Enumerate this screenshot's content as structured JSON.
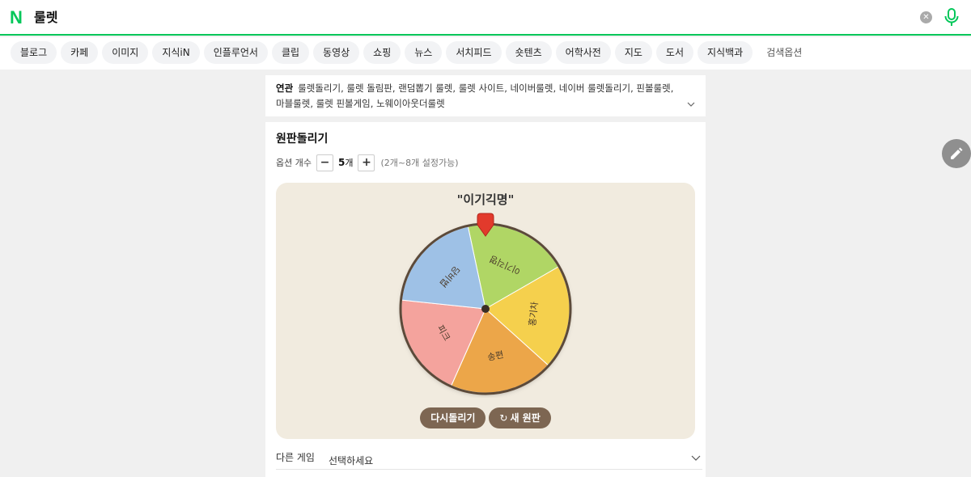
{
  "header": {
    "logo": "N",
    "query": "룰렛",
    "clear_icon": "close-circle-icon",
    "mic_icon": "microphone-icon"
  },
  "tabs": [
    "블로그",
    "카페",
    "이미지",
    "지식iN",
    "인플루언서",
    "클립",
    "동영상",
    "쇼핑",
    "뉴스",
    "서치피드",
    "숏텐츠",
    "어학사전",
    "지도",
    "도서",
    "지식백과"
  ],
  "search_options": "검색옵션",
  "related": {
    "label": "연관",
    "text": "룰렛돌리기, 룰렛 돌림판, 랜덤뽑기 룰렛, 룰렛 사이트, 네이버룰렛, 네이버 룰렛돌리기, 핀볼룰렛, 마블룰렛, 룰렛 핀볼게임, 노웨이아웃더룰렛"
  },
  "roulette": {
    "title": "원판돌리기",
    "option_label": "옵션 개수",
    "minus": "−",
    "plus": "+",
    "count": "5",
    "count_unit": "개",
    "hint": "(2개~8개 설정가능)",
    "result": "\"이기긱명\"",
    "segments": [
      {
        "label": "이기긱명",
        "color": "#b0d665"
      },
      {
        "label": "홍기차",
        "color": "#f5d04d"
      },
      {
        "label": "송편",
        "color": "#eca64a"
      },
      {
        "label": "피크",
        "color": "#f4a39d"
      },
      {
        "label": "당비법",
        "color": "#9ec1e6"
      }
    ],
    "respin_label": "다시돌리기",
    "new_wheel_label": "새 원판",
    "other_game_label": "다른 게임",
    "other_game_value": "선택하세요"
  }
}
